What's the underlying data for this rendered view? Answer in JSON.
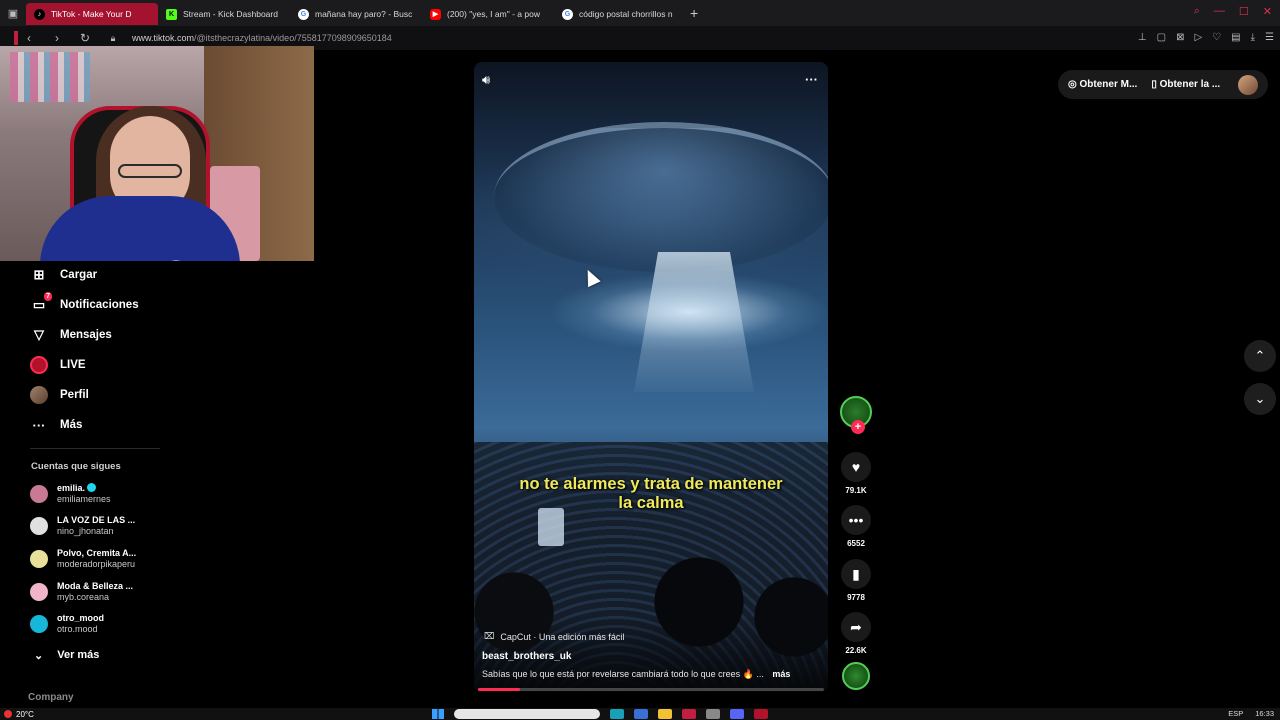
{
  "browser": {
    "tabs": [
      {
        "label": "TikTok - Make Your D",
        "active": true,
        "icon": "tiktok-icon",
        "color": "#ffffff"
      },
      {
        "label": "Stream - Kick Dashboard",
        "active": false,
        "icon": "kick-icon",
        "color": "#53fc18"
      },
      {
        "label": "mañana hay paro? - Busc",
        "active": false,
        "icon": "google-icon",
        "color": "#ffffff"
      },
      {
        "label": "(200) \"yes, I am\" - a pow",
        "active": false,
        "icon": "youtube-icon",
        "color": "#ff0000"
      },
      {
        "label": "código postal chorrillos n",
        "active": false,
        "icon": "google-icon",
        "color": "#ffffff"
      }
    ],
    "new_tab": "+",
    "url_host": "www.tiktok.com",
    "url_path": "/@itsthecrazylatina/video/7558177098909650184"
  },
  "sidebar": {
    "items": [
      {
        "label": "Cargar",
        "icon": "upload-icon",
        "glyph": "⊞"
      },
      {
        "label": "Notificaciones",
        "icon": "inbox-icon",
        "glyph": "▭",
        "badge": "7"
      },
      {
        "label": "Mensajes",
        "icon": "send-icon",
        "glyph": "▽"
      },
      {
        "label": "LIVE",
        "icon": "live-icon",
        "glyph": "LIVE"
      },
      {
        "label": "Perfil",
        "icon": "profile-avatar",
        "glyph": ""
      },
      {
        "label": "Más",
        "icon": "more-icon",
        "glyph": "···"
      }
    ],
    "following_title": "Cuentas que sigues",
    "following": [
      {
        "name": "emilia.",
        "handle": "emiliamernes",
        "verified": true,
        "color": "#c87a95"
      },
      {
        "name": "LA VOZ DE LAS ...",
        "handle": "nino_jhonatan",
        "verified": false,
        "color": "#e0e0e0"
      },
      {
        "name": "Polvo, Cremita A...",
        "handle": "moderadorpikaperu",
        "verified": false,
        "color": "#e8df9a"
      },
      {
        "name": "Moda & Belleza ...",
        "handle": "myb.coreana",
        "verified": false,
        "color": "#f2b4c9"
      },
      {
        "name": "otro_mood",
        "handle": "otro.mood",
        "verified": false,
        "color": "#17b7d9"
      }
    ],
    "see_more": "Ver más",
    "company": "Company"
  },
  "video": {
    "subtitle_line1": "no te alarmes y trata de mantener",
    "subtitle_line2": "la calma",
    "capcut": "CapCut · Una edición más fácil",
    "author": "beast_brothers_uk",
    "description": "Sabías que lo que está por revelarse cambiará todo lo que crees 🔥 ...",
    "more": "más",
    "progress": 0.12
  },
  "actions": {
    "likes": "79.1K",
    "comments": "6552",
    "saves": "9778",
    "shares": "22.6K"
  },
  "topright": {
    "get_app_1": "Obtener M...",
    "get_app_2": "Obtener la ..."
  },
  "taskbar": {
    "weather": "20°C",
    "lang": "ESP",
    "time": "16:33"
  },
  "colors": {
    "accent": "#fe2c55",
    "active_tab": "#a3122f"
  }
}
